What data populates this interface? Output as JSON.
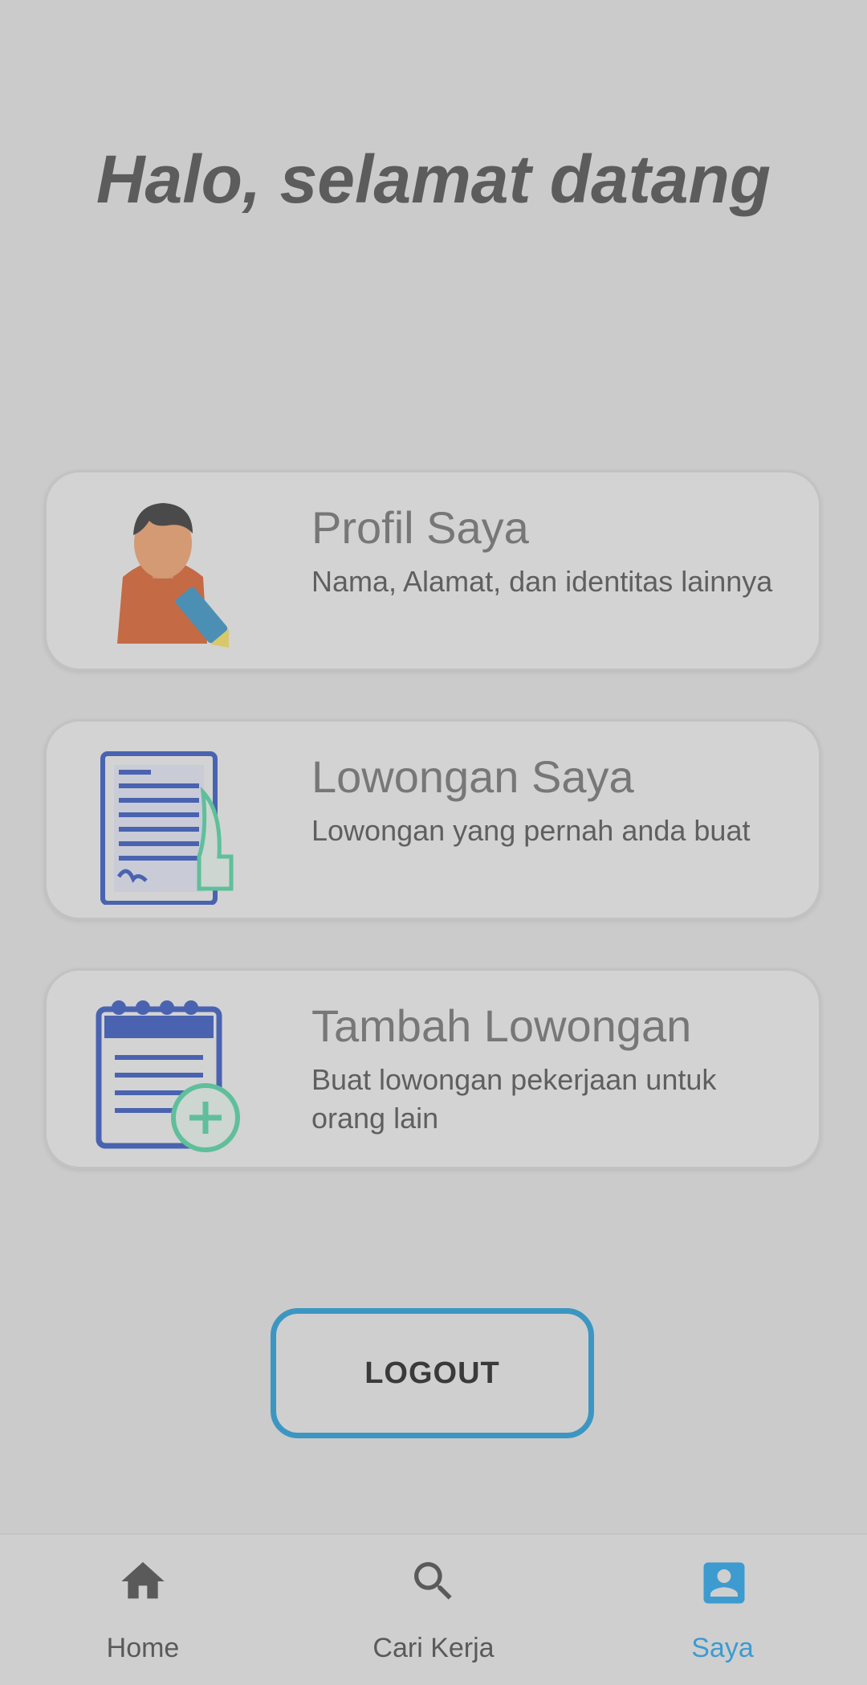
{
  "greeting": "Halo, selamat datang",
  "menu": [
    {
      "icon": "profile-edit-icon",
      "title": "Profil Saya",
      "description": "Nama, Alamat, dan identitas lainnya"
    },
    {
      "icon": "document-sign-icon",
      "title": "Lowongan Saya",
      "description": "Lowongan yang pernah anda buat"
    },
    {
      "icon": "notepad-add-icon",
      "title": "Tambah Lowongan",
      "description": "Buat lowongan pekerjaan untuk orang lain"
    }
  ],
  "logout_label": "LOGOUT",
  "nav": [
    {
      "icon": "home-icon",
      "label": "Home",
      "active": false
    },
    {
      "icon": "search-icon",
      "label": "Cari Kerja",
      "active": false
    },
    {
      "icon": "account-box-icon",
      "label": "Saya",
      "active": true
    }
  ],
  "colors": {
    "accent": "#3d9bd0",
    "background": "#cbcbcb",
    "card": "#d3d3d3"
  }
}
